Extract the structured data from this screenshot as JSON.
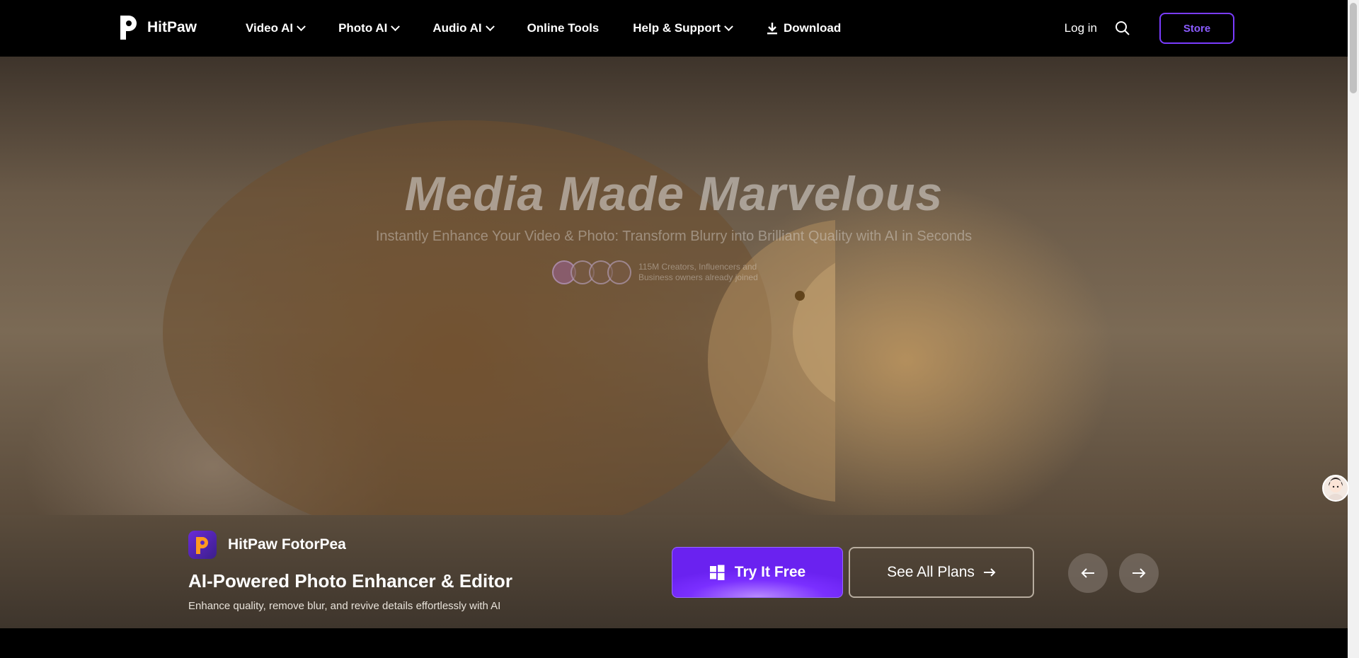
{
  "header": {
    "brand": "HitPaw",
    "nav": [
      {
        "label": "Video AI",
        "dropdown": true
      },
      {
        "label": "Photo AI",
        "dropdown": true
      },
      {
        "label": "Audio AI",
        "dropdown": true
      },
      {
        "label": "Online Tools",
        "dropdown": false
      },
      {
        "label": "Help & Support",
        "dropdown": true
      },
      {
        "label": "Download",
        "icon": "download-icon"
      }
    ],
    "login": "Log in",
    "store": "Store",
    "accent_color": "#7a3cff"
  },
  "hero": {
    "title": "Media Made Marvelous",
    "subtitle": "Instantly Enhance Your Video & Photo: Transform Blurry into Brilliant Quality with AI in Seconds",
    "creators_text": "115M Creators, Influencers and Business owners already joined"
  },
  "product": {
    "name": "HitPaw FotorPea",
    "headline": "AI-Powered Photo Enhancer & Editor",
    "description": "Enhance quality, remove blur, and revive details effortlessly with AI",
    "try_label": "Try It Free",
    "plans_label": "See All Plans"
  }
}
